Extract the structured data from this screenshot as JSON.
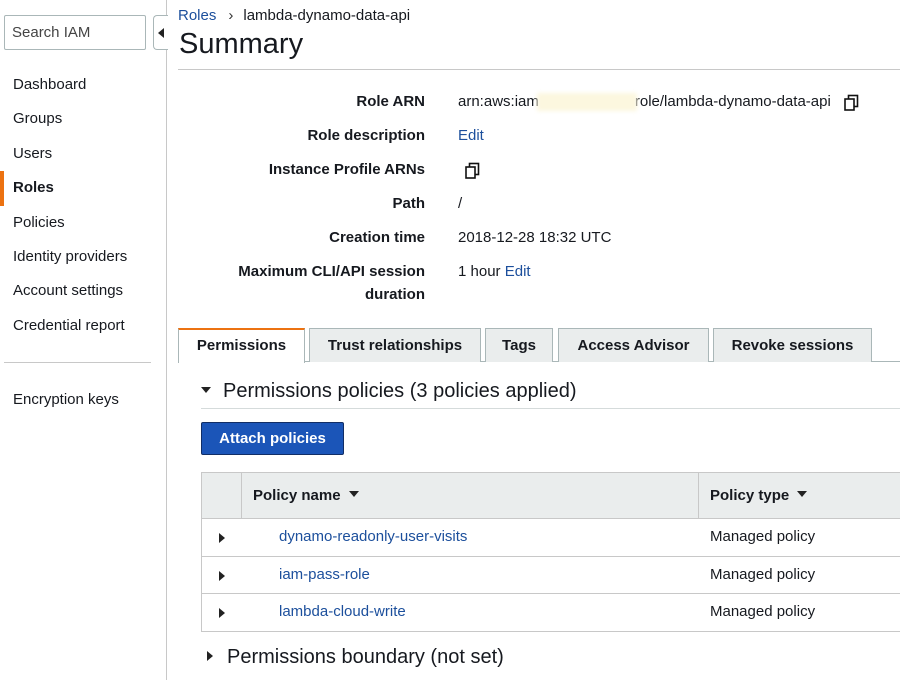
{
  "sidebar": {
    "search_placeholder": "Search IAM",
    "items": [
      {
        "label": "Dashboard"
      },
      {
        "label": "Groups"
      },
      {
        "label": "Users"
      },
      {
        "label": "Roles",
        "active": true
      },
      {
        "label": "Policies"
      },
      {
        "label": "Identity providers"
      },
      {
        "label": "Account settings"
      },
      {
        "label": "Credential report"
      }
    ],
    "secondary": [
      {
        "label": "Encryption keys"
      }
    ]
  },
  "breadcrumb": {
    "parent": "Roles",
    "current": "lambda-dynamo-data-api"
  },
  "page_title": "Summary",
  "summary": {
    "role_arn_label": "Role ARN",
    "role_arn_prefix": "arn:aws:iam",
    "role_arn_suffix": "role/lambda-dynamo-data-api",
    "role_description_label": "Role description",
    "role_description_link": "Edit",
    "instance_profile_label": "Instance Profile ARNs",
    "path_label": "Path",
    "path_value": "/",
    "creation_time_label": "Creation time",
    "creation_time_value": "2018-12-28 18:32 UTC",
    "max_session_label_line1": "Maximum CLI/API session",
    "max_session_label_line2": "duration",
    "max_session_value": "1 hour",
    "max_session_link": "Edit"
  },
  "tabs": [
    {
      "label": "Permissions",
      "active": true
    },
    {
      "label": "Trust relationships"
    },
    {
      "label": "Tags"
    },
    {
      "label": "Access Advisor"
    },
    {
      "label": "Revoke sessions"
    }
  ],
  "permissions": {
    "section_title": "Permissions policies (3 policies applied)",
    "attach_button": "Attach policies",
    "columns": {
      "name": "Policy name",
      "type": "Policy type"
    },
    "policies": [
      {
        "name": "dynamo-readonly-user-visits",
        "type": "Managed policy"
      },
      {
        "name": "iam-pass-role",
        "type": "Managed policy"
      },
      {
        "name": "lambda-cloud-write",
        "type": "Managed policy"
      }
    ],
    "boundary_title": "Permissions boundary (not set)"
  },
  "colors": {
    "accent": "#ec7211",
    "link": "#1c4f9c",
    "primary_button": "#1b55b8"
  }
}
